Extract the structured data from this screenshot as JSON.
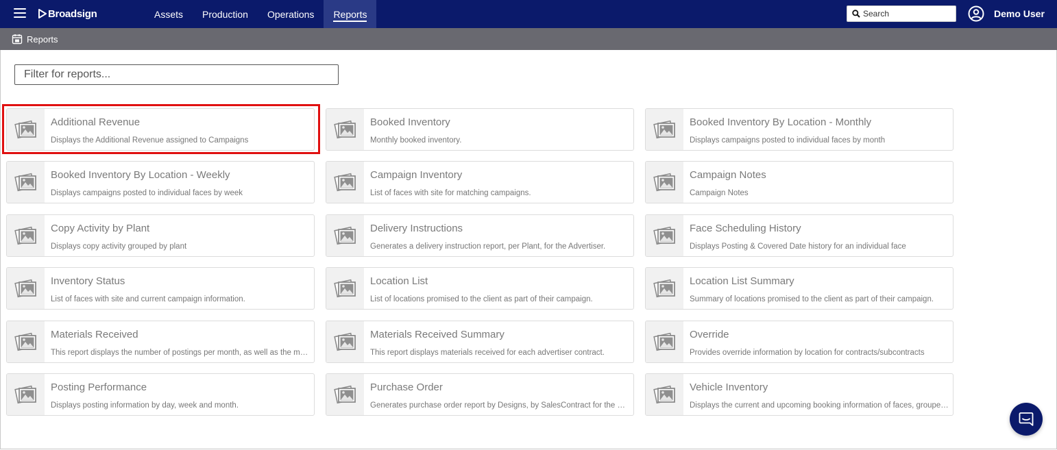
{
  "header": {
    "brand": "Broadsign",
    "nav": [
      {
        "label": "Assets",
        "active": false
      },
      {
        "label": "Production",
        "active": false
      },
      {
        "label": "Operations",
        "active": false
      },
      {
        "label": "Reports",
        "active": true
      }
    ],
    "search_placeholder": "Search",
    "user_name": "Demo User"
  },
  "subheader": {
    "title": "Reports"
  },
  "filter": {
    "placeholder": "Filter for reports...",
    "value": ""
  },
  "reports": [
    {
      "title": "Additional Revenue",
      "description": "Displays the Additional Revenue assigned to Campaigns"
    },
    {
      "title": "Booked Inventory",
      "description": "Monthly booked inventory."
    },
    {
      "title": "Booked Inventory By Location - Monthly",
      "description": "Displays campaigns posted to individual faces by month"
    },
    {
      "title": "Booked Inventory By Location - Weekly",
      "description": "Displays campaigns posted to individual faces by week"
    },
    {
      "title": "Campaign Inventory",
      "description": "List of faces with site for matching campaigns."
    },
    {
      "title": "Campaign Notes",
      "description": "Campaign Notes"
    },
    {
      "title": "Copy Activity by Plant",
      "description": "Displays copy activity grouped by plant"
    },
    {
      "title": "Delivery Instructions",
      "description": "Generates a delivery instruction report, per Plant, for the Advertiser."
    },
    {
      "title": "Face Scheduling History",
      "description": "Displays Posting & Covered Date history for an individual face"
    },
    {
      "title": "Inventory Status",
      "description": "List of faces with site and current campaign information."
    },
    {
      "title": "Location List",
      "description": "List of locations promised to the client as part of their campaign."
    },
    {
      "title": "Location List Summary",
      "description": "Summary of locations promised to the client as part of their campaign."
    },
    {
      "title": "Materials Received",
      "description": "This report displays the number of postings per month, as well as the mat..."
    },
    {
      "title": "Materials Received Summary",
      "description": "This report displays materials received for each advertiser contract."
    },
    {
      "title": "Override",
      "description": "Provides override information by location for contracts/subcontracts"
    },
    {
      "title": "Posting Performance",
      "description": "Displays posting information by day, week and month."
    },
    {
      "title": "Purchase Order",
      "description": "Generates purchase order report by Designs, by SalesContract for the Ven..."
    },
    {
      "title": "Vehicle Inventory",
      "description": "Displays the current and upcoming booking information of faces, grouped..."
    }
  ],
  "colors": {
    "topbar": "#0b1a6b",
    "subbar": "#696970",
    "highlight": "#e01010"
  },
  "icons": {
    "menu": "hamburger-icon",
    "search": "search-icon",
    "user": "user-circle-icon",
    "subheader": "calendar-icon",
    "report_thumb": "image-placeholder-icon",
    "chat": "chat-icon"
  }
}
